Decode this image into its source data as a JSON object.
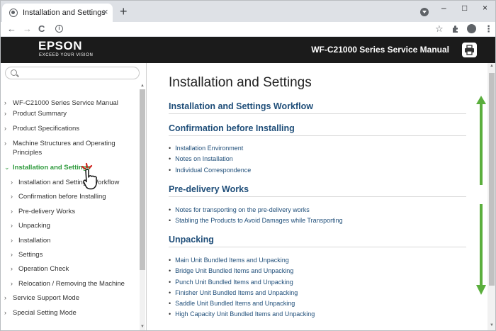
{
  "browser": {
    "tab_title": "Installation and Settings",
    "tab_close": "×",
    "new_tab": "+",
    "back": "←",
    "forward": "→",
    "reload": "C",
    "info": "i",
    "star": "☆",
    "menu": "⋮",
    "minimize": "–",
    "maximize": "□",
    "close": "×"
  },
  "header": {
    "logo": "EPSON",
    "tagline": "EXCEED YOUR VISION",
    "manual_title": "WF-C21000 Series Service Manual"
  },
  "sidebar": {
    "search_placeholder": "",
    "items": [
      {
        "label": "WF-C21000 Series Service Manual",
        "level": "top",
        "chevron": "›"
      },
      {
        "label": "Product Summary",
        "level": "top",
        "chevron": "›"
      },
      {
        "label": "Product Specifications",
        "level": "top",
        "chevron": "›"
      },
      {
        "label": "Machine Structures and Operating Principles",
        "level": "top",
        "chevron": "›"
      },
      {
        "label": "Installation and Settings",
        "level": "top",
        "chevron": "⌄",
        "active": true
      },
      {
        "label": "Installation and Settings Workflow",
        "level": "sub",
        "chevron": "›"
      },
      {
        "label": "Confirmation before Installing",
        "level": "sub",
        "chevron": "›"
      },
      {
        "label": "Pre-delivery Works",
        "level": "sub",
        "chevron": "›"
      },
      {
        "label": "Unpacking",
        "level": "sub",
        "chevron": "›"
      },
      {
        "label": "Installation",
        "level": "sub",
        "chevron": "›"
      },
      {
        "label": "Settings",
        "level": "sub",
        "chevron": "›"
      },
      {
        "label": "Operation Check",
        "level": "sub",
        "chevron": "›"
      },
      {
        "label": "Relocation / Removing the Machine",
        "level": "sub",
        "chevron": "›"
      },
      {
        "label": "Service Support Mode",
        "level": "top",
        "chevron": "›"
      },
      {
        "label": "Special Setting Mode",
        "level": "top",
        "chevron": "›"
      }
    ]
  },
  "content": {
    "title": "Installation and Settings",
    "sections": [
      {
        "title": "Installation and Settings Workflow",
        "links": []
      },
      {
        "title": "Confirmation before Installing",
        "links": [
          "Installation Environment",
          "Notes on Installation",
          "Individual Correspondence"
        ]
      },
      {
        "title": "Pre-delivery Works",
        "links": [
          "Notes for transporting on the pre-delivery works",
          "Stabling the Products to Avoid Damages while Transporting"
        ]
      },
      {
        "title": "Unpacking",
        "links": [
          "Main Unit Bundled Items and Unpacking",
          "Bridge Unit Bundled Items and Unpacking",
          "Punch Unit Bundled Items and Unpacking",
          "Finisher Unit Bundled Items and Unpacking",
          "Saddle Unit Bundled Items and Unpacking",
          "High Capacity Unit Bundled Items and Unpacking"
        ]
      }
    ]
  },
  "colors": {
    "accent_green": "#2e9a3c",
    "link_blue": "#1f4e79",
    "header_bg": "#1b1b1b"
  },
  "icons": [
    "globe-icon",
    "search-icon",
    "print-icon",
    "hand-cursor-icon",
    "scroll-arrow-icon"
  ]
}
